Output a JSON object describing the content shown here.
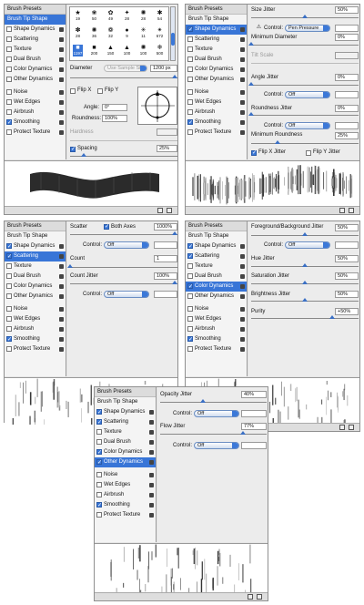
{
  "common": {
    "presets": "Brush Presets",
    "tip": "Brush Tip Shape",
    "shape": "Shape Dynamics",
    "scat": "Scattering",
    "tex": "Texture",
    "dual": "Dual Brush",
    "color": "Color Dynamics",
    "other": "Other Dynamics",
    "noise": "Noise",
    "wet": "Wet Edges",
    "air": "Airbrush",
    "smooth": "Smoothing",
    "protect": "Protect Texture",
    "control": "Control:",
    "off": "Off"
  },
  "p1": {
    "sizes": [
      "19",
      "50",
      "49",
      "28",
      "28",
      "54",
      "28",
      "36",
      "32",
      "9",
      "11",
      "672",
      "1197",
      "200",
      "150",
      "100",
      "100",
      "500"
    ],
    "icons": [
      "★",
      "❀",
      "✿",
      "✦",
      "✺",
      "✱",
      "✽",
      "✺",
      "❁",
      "●",
      "✳",
      "✴",
      "■",
      "■",
      "▲",
      "▲",
      "✺",
      "❄"
    ],
    "diameter": "Diameter",
    "use_sample": "Use Sample Size",
    "diam_val": "1200 px",
    "flipx": "Flip X",
    "flipy": "Flip Y",
    "angle": "Angle:",
    "angle_val": "0°",
    "round": "Roundness:",
    "round_val": "100%",
    "hard": "Hardness",
    "spacing": "Spacing",
    "spacing_val": "25%"
  },
  "p2": {
    "size_jit": "Size Jitter",
    "size_jit_val": "50%",
    "ctrl_val": "Pen Pressure",
    "min_diam": "Minimum Diameter",
    "min_diam_val": "0%",
    "tilt": "Tilt Scale",
    "angle_jit": "Angle Jitter",
    "angle_jit_val": "0%",
    "round_jit": "Roundness Jitter",
    "round_jit_val": "0%",
    "min_round": "Minimum Roundness",
    "min_round_val": "25%",
    "flipx": "Flip X Jitter",
    "flipy": "Flip Y Jitter"
  },
  "p3": {
    "scatter": "Scatter",
    "both": "Both Axes",
    "scatter_val": "1000%",
    "count": "Count",
    "count_val": "1",
    "count_jit": "Count Jitter",
    "count_jit_val": "100%"
  },
  "p4": {
    "fgbg": "Foreground/Background Jitter",
    "fgbg_val": "50%",
    "hue": "Hue Jitter",
    "hue_val": "50%",
    "sat": "Saturation Jitter",
    "sat_val": "50%",
    "bri": "Brightness Jitter",
    "bri_val": "50%",
    "pur": "Purity",
    "pur_val": "+50%"
  },
  "p5": {
    "opac": "Opacity Jitter",
    "opac_val": "40%",
    "flow": "Flow Jitter",
    "flow_val": "77%"
  }
}
